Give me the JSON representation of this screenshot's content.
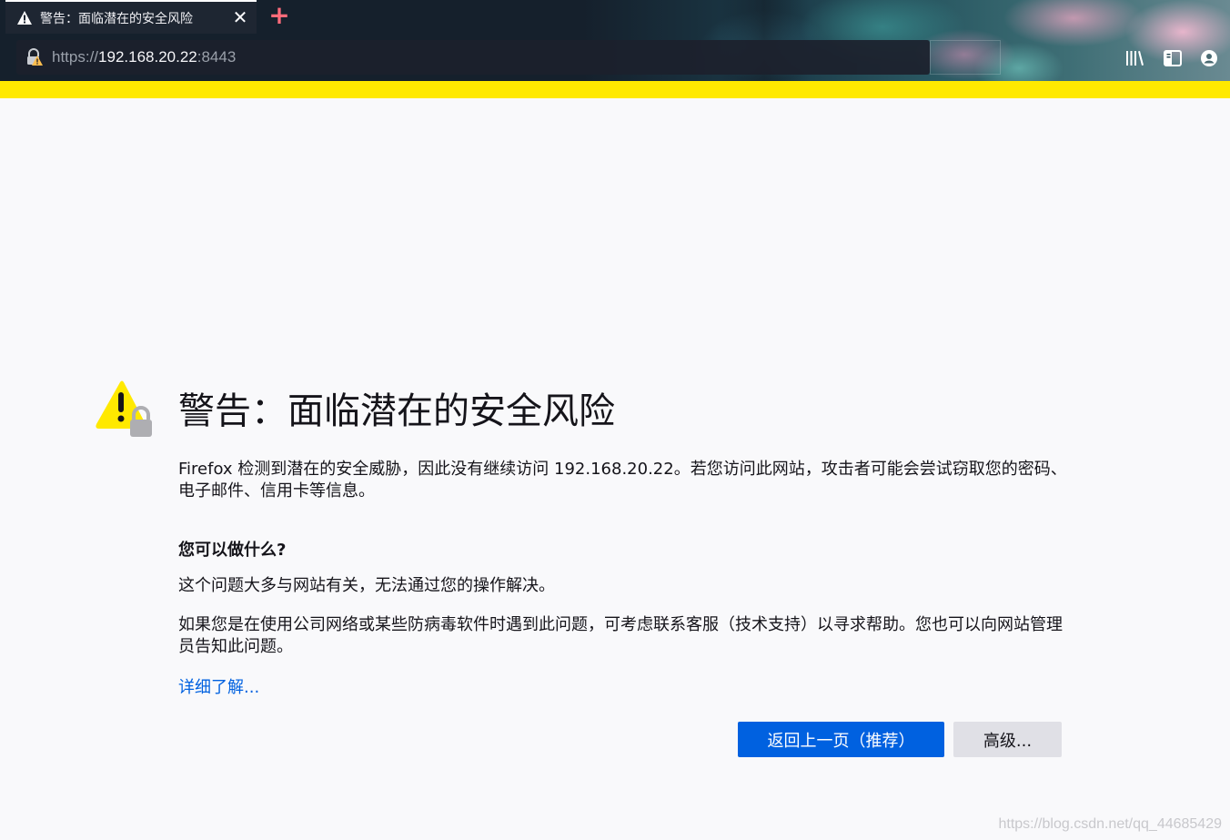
{
  "tab": {
    "title": "警告：面临潜在的安全风险",
    "close_glyph": "✕",
    "new_tab_glyph": "+"
  },
  "urlbar": {
    "scheme": "https://",
    "host": "192.168.20.22",
    "port": ":8443"
  },
  "toolbar_icons": [
    "library-icon",
    "sidebar-icon",
    "account-icon"
  ],
  "error_page": {
    "title": "警告：面临潜在的安全风险",
    "description": "Firefox 检测到潜在的安全威胁，因此没有继续访问 192.168.20.22。若您访问此网站，攻击者可能会尝试窃取您的密码、电子邮件、信用卡等信息。",
    "what_can_you_do": "您可以做什么?",
    "p1": "这个问题大多与网站有关，无法通过您的操作解决。",
    "p2": "如果您是在使用公司网络或某些防病毒软件时遇到此问题，可考虑联系客服（技术支持）以寻求帮助。您也可以向网站管理员告知此问题。",
    "learn_more": "详细了解...",
    "back_button": "返回上一页（推荐）",
    "advanced_button": "高级..."
  },
  "watermark": "https://blog.csdn.net/qq_44685429",
  "colors": {
    "accent": "#0061e0",
    "warning_bar": "#ffe900",
    "warning_icon": "#ffe900"
  }
}
